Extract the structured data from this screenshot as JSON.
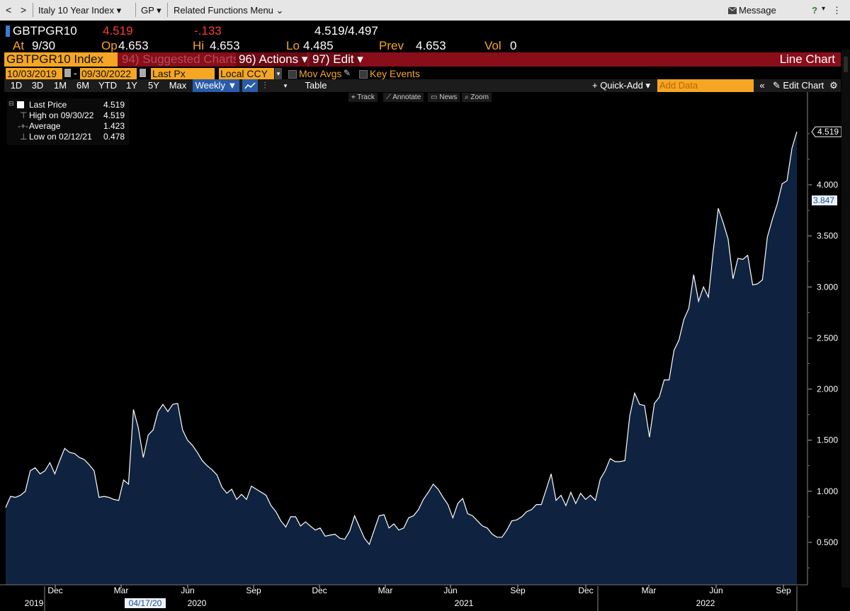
{
  "topbar": {
    "back": "<",
    "forward": ">",
    "security_menu": "Italy 10 Year Index ▾",
    "gp_menu": "GP ▾",
    "related": "Related Functions Menu ⌄",
    "message": "Message",
    "help": "?"
  },
  "quote": {
    "ticker": "GBTPGR10",
    "last": "4.519",
    "change": "-.133",
    "bid_ask": "4.519/4.497",
    "at_label": "At",
    "at_value": "9/30",
    "op_label": "Op",
    "op_value": "4.653",
    "hi_label": "Hi",
    "hi_value": "4.653",
    "lo_label": "Lo",
    "lo_value": "4.485",
    "prev_label": "Prev",
    "prev_value": "4.653",
    "vol_label": "Vol",
    "vol_value": "0"
  },
  "redbar": {
    "index_name": "GBTPGR10 Index",
    "suggested": "94) Suggested Charts",
    "actions": "96) Actions ▾",
    "edit": "97) Edit ▾",
    "chart_type": "Line Chart"
  },
  "controls": {
    "start_date": "10/03/2019",
    "dash": "-",
    "end_date": "09/30/2022",
    "field": "Last Px",
    "currency": "Local CCY",
    "mov_avgs": "Mov Avgs",
    "key_events": "Key Events"
  },
  "ranges": {
    "items": [
      "1D",
      "3D",
      "1M",
      "6M",
      "YTD",
      "1Y",
      "5Y",
      "Max"
    ],
    "period": "Weekly ▼",
    "table": "Table",
    "quick_add": "+ Quick-Add ▾",
    "add_data_placeholder": "Add Data",
    "edit_chart": "Edit Chart"
  },
  "tools": {
    "track": "Track",
    "annotate": "Annotate",
    "news": "News",
    "zoom": "Zoom"
  },
  "legend": {
    "last_label": "Last Price",
    "last_value": "4.519",
    "high_label": "High on 09/30/22",
    "high_value": "4.519",
    "avg_label": "Average",
    "avg_value": "1.423",
    "low_label": "Low on 02/12/21",
    "low_value": "0.478"
  },
  "badges": {
    "last": "4.519",
    "ref": "3.847",
    "date_marker": "04/17/20"
  },
  "colors": {
    "series_fill": "#0f2340",
    "series_line": "#ffffff",
    "orange": "#f5a623",
    "red_bar": "#8a0d1a"
  },
  "chart_data": {
    "type": "area",
    "title": "",
    "xlabel": "",
    "ylabel": "",
    "ylim": [
      0.1,
      4.75
    ],
    "x_ticks": [
      "Dec",
      "Mar",
      "Jun",
      "Sep",
      "Dec",
      "Mar",
      "Jun",
      "Sep",
      "Dec",
      "Mar",
      "Jun",
      "Sep"
    ],
    "year_labels": [
      "2019",
      "2020",
      "2021",
      "2022"
    ],
    "y_ticks": [
      0.5,
      1.0,
      1.5,
      2.0,
      2.5,
      3.0,
      3.5,
      4.0
    ],
    "y_tick_labels": [
      "0.500",
      "1.000",
      "1.500",
      "2.000",
      "2.500",
      "3.000",
      "3.500",
      "4.000"
    ],
    "grid": false,
    "legend_position": "top-left",
    "series": [
      {
        "name": "Last Price",
        "values": [
          0.84,
          0.95,
          0.94,
          0.96,
          1.0,
          1.2,
          1.23,
          1.17,
          1.2,
          1.28,
          1.17,
          1.3,
          1.42,
          1.38,
          1.37,
          1.33,
          1.31,
          1.26,
          1.2,
          0.94,
          0.95,
          0.94,
          0.92,
          0.91,
          1.11,
          1.07,
          1.8,
          1.62,
          1.33,
          1.55,
          1.6,
          1.78,
          1.85,
          1.78,
          1.85,
          1.86,
          1.6,
          1.5,
          1.45,
          1.38,
          1.3,
          1.25,
          1.21,
          1.16,
          1.04,
          0.98,
          1.02,
          0.92,
          0.97,
          0.92,
          1.05,
          1.02,
          0.99,
          0.96,
          0.86,
          0.8,
          0.71,
          0.65,
          0.75,
          0.75,
          0.66,
          0.7,
          0.66,
          0.62,
          0.64,
          0.56,
          0.57,
          0.58,
          0.54,
          0.53,
          0.61,
          0.76,
          0.65,
          0.54,
          0.48,
          0.62,
          0.76,
          0.77,
          0.64,
          0.68,
          0.62,
          0.64,
          0.74,
          0.76,
          0.82,
          0.92,
          0.99,
          1.07,
          1.02,
          0.94,
          0.87,
          0.74,
          0.88,
          0.93,
          0.78,
          0.76,
          0.71,
          0.66,
          0.64,
          0.58,
          0.55,
          0.55,
          0.62,
          0.71,
          0.72,
          0.75,
          0.8,
          0.82,
          0.87,
          0.87,
          1.02,
          1.17,
          0.91,
          0.96,
          0.86,
          0.99,
          0.88,
          0.98,
          0.92,
          0.96,
          0.91,
          1.12,
          1.2,
          1.32,
          1.29,
          1.29,
          1.3,
          1.74,
          1.96,
          1.85,
          1.84,
          1.53,
          1.86,
          1.92,
          2.09,
          2.09,
          2.38,
          2.48,
          2.68,
          2.79,
          3.12,
          2.86,
          3.0,
          2.9,
          3.36,
          3.77,
          3.63,
          3.47,
          3.08,
          3.28,
          3.27,
          3.31,
          3.02,
          3.03,
          3.07,
          3.49,
          3.66,
          3.81,
          4.01,
          4.04,
          4.36,
          4.519
        ]
      }
    ]
  }
}
